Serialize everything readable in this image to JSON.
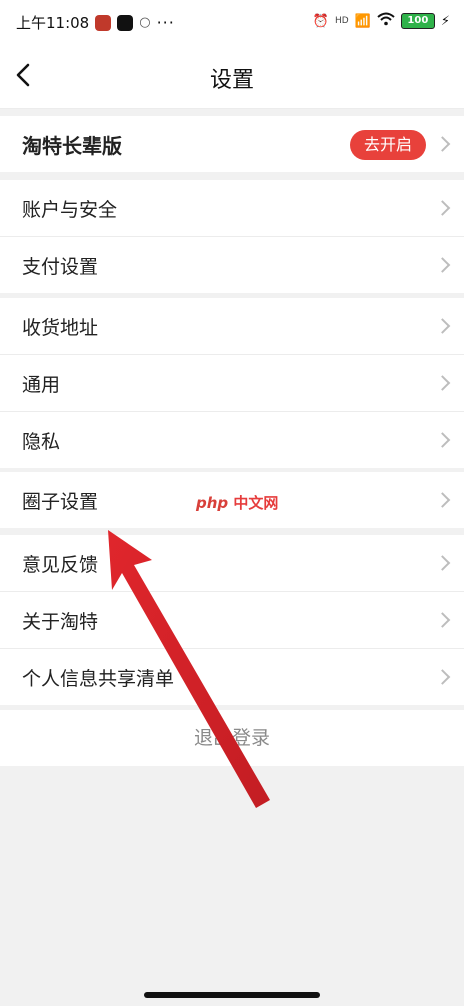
{
  "status_bar": {
    "time": "上午11:08",
    "network_speed": "HD",
    "battery": "100"
  },
  "nav": {
    "title": "设置"
  },
  "elder_row": {
    "label": "淘特长辈版",
    "button_label": "去开启",
    "button_color": "#e8413b"
  },
  "groups": {
    "account": [
      "账户与安全",
      "支付设置"
    ],
    "general": [
      "收货地址",
      "通用",
      "隐私"
    ],
    "circle": [
      "圈子设置"
    ],
    "about": [
      "意见反馈",
      "关于淘特",
      "个人信息共享清单"
    ]
  },
  "logout_label": "退出登录",
  "watermark": {
    "php": "php",
    "text": "中文网"
  },
  "colors": {
    "accent": "#e8413b",
    "background": "#f1f1f1"
  },
  "icons": [
    "back-icon",
    "chevron-right-icon",
    "wifi-icon",
    "signal-icon",
    "alarm-icon"
  ]
}
